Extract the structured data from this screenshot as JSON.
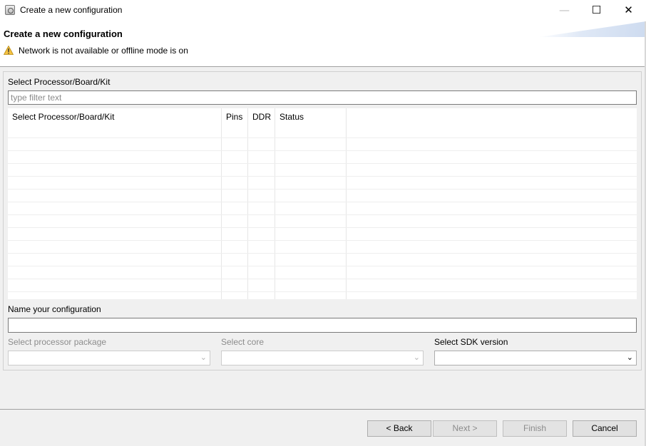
{
  "window": {
    "title": "Create a new configuration",
    "minimize_glyph": "—",
    "maximize_glyph": "☐",
    "close_glyph": "✕"
  },
  "header": {
    "title": "Create a new configuration",
    "warning_text": "Network is not available or offline mode is on",
    "warning_color": "#f5c242"
  },
  "selector": {
    "group_label": "Select Processor/Board/Kit",
    "filter_placeholder": "type filter text",
    "filter_value": "",
    "columns": [
      "Select Processor/Board/Kit",
      "Pins",
      "DDR",
      "Status",
      ""
    ],
    "rows": []
  },
  "config_name": {
    "label": "Name your configuration",
    "value": ""
  },
  "package": {
    "label": "Select processor package",
    "value": "",
    "enabled": false
  },
  "core": {
    "label": "Select core",
    "value": "",
    "enabled": false
  },
  "sdk": {
    "label": "Select SDK version",
    "value": "",
    "enabled": true
  },
  "buttons": {
    "back": "< Back",
    "next": "Next >",
    "finish": "Finish",
    "cancel": "Cancel"
  }
}
